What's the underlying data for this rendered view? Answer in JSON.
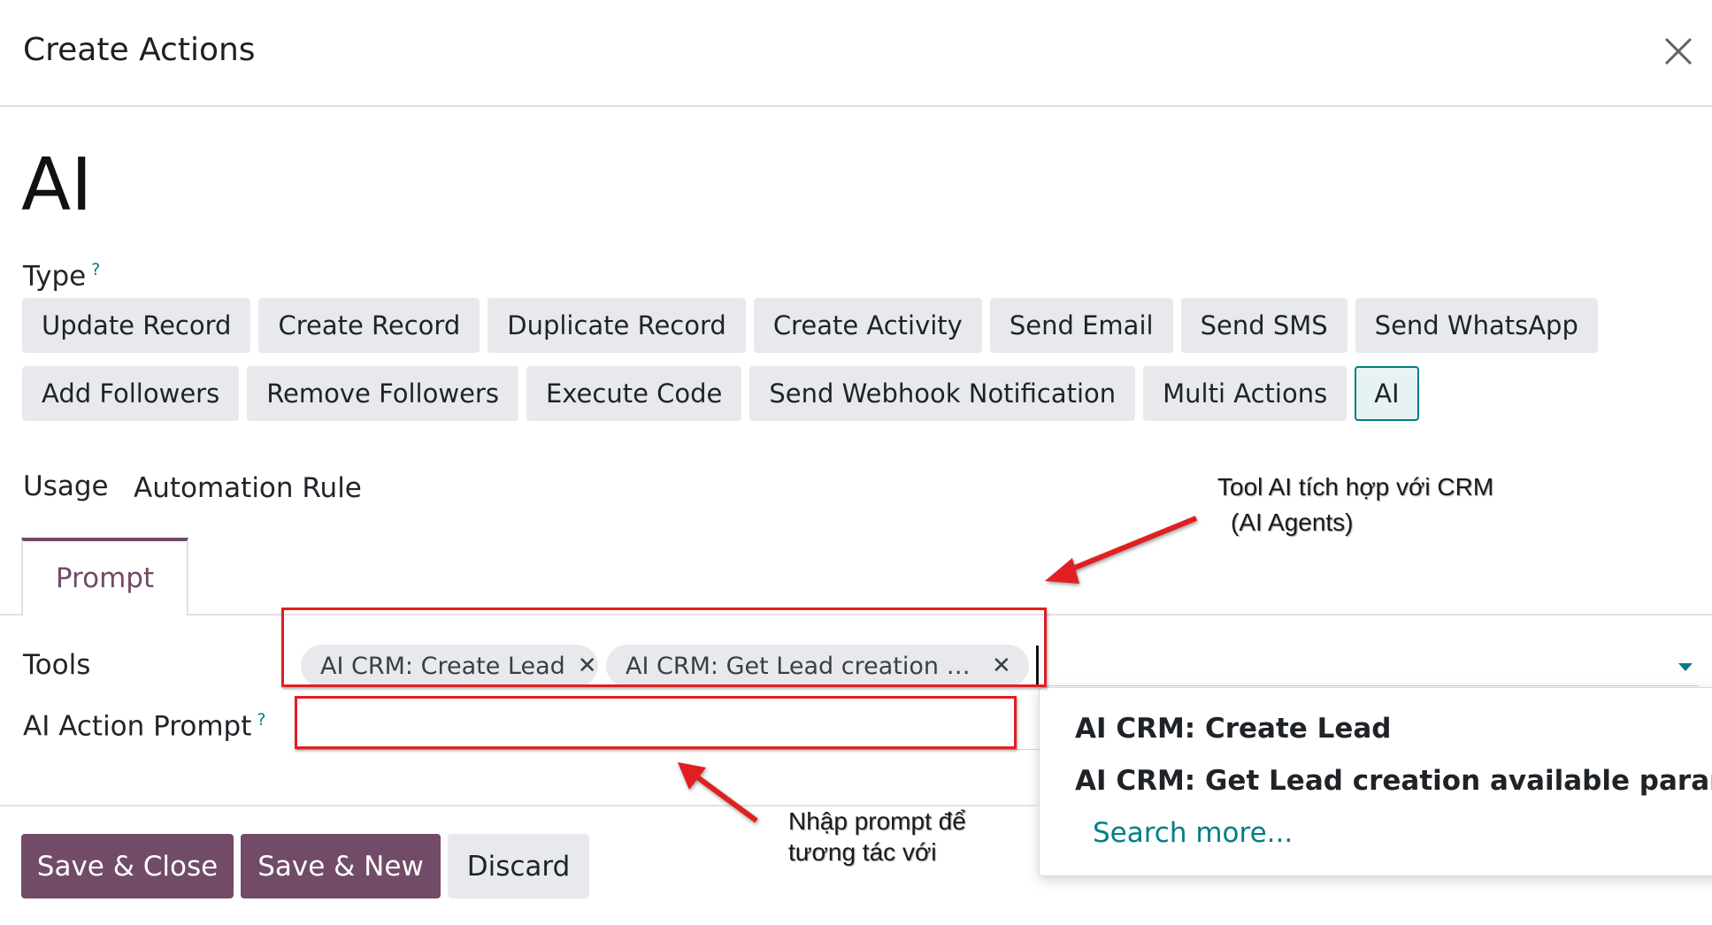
{
  "header": {
    "title": "Create Actions"
  },
  "record": {
    "name": "AI"
  },
  "type_field": {
    "label": "Type",
    "help": "?",
    "row1": [
      "Update Record",
      "Create Record",
      "Duplicate Record",
      "Create Activity",
      "Send Email",
      "Send SMS",
      "Send WhatsApp"
    ],
    "row2": [
      "Add Followers",
      "Remove Followers",
      "Execute Code",
      "Send Webhook Notification",
      "Multi Actions",
      "AI"
    ],
    "selected": "AI"
  },
  "usage": {
    "label": "Usage",
    "value": "Automation Rule"
  },
  "tabs": [
    {
      "label": "Prompt"
    }
  ],
  "tools": {
    "label": "Tools",
    "tags": [
      "AI CRM: Create Lead",
      "AI CRM: Get Lead creation av..."
    ],
    "remove_glyph": "✕"
  },
  "ai_prompt": {
    "label": "AI Action Prompt",
    "help": "?",
    "value": ""
  },
  "dropdown": {
    "items": [
      "AI CRM: Create Lead",
      "AI CRM: Get Lead creation available paramete"
    ],
    "search_more": "Search more..."
  },
  "footer": {
    "save_close": "Save & Close",
    "save_new": "Save & New",
    "discard": "Discard"
  },
  "annotations": {
    "note1_line1": "Tool AI tích hợp với CRM",
    "note1_line2": "(AI Agents)",
    "note2_line1": "Nhập prompt để",
    "note2_line2": "tương tác với"
  },
  "colors": {
    "primary": "#714b67",
    "accent": "#017e84",
    "annotation": "#e01f22"
  }
}
